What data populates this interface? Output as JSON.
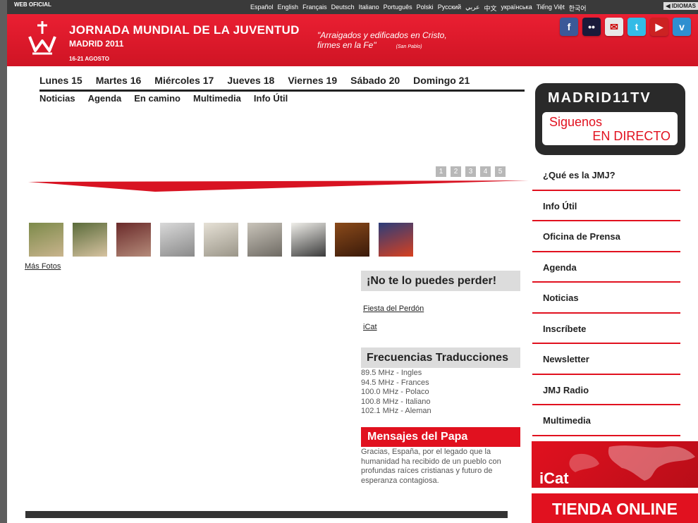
{
  "topbar": {
    "label": "WEB OFICIAL",
    "languages": [
      "Español",
      "English",
      "Français",
      "Deutsch",
      "Italiano",
      "Português",
      "Polski",
      "Русский",
      "عربي",
      "中文",
      "українська",
      "Tiếng Việt",
      "한국어"
    ],
    "idiomas": "◀ IDIOMAS"
  },
  "header": {
    "title": "JORNADA MUNDIAL DE LA JUVENTUD",
    "city": "MADRID 2011",
    "dates": "16-21 AGOSTO",
    "quote_line1": "\"Arraigados y edificados en Cristo,",
    "quote_line2": "firmes en la Fe\"",
    "quote_source": "(San Pablo)"
  },
  "social": [
    {
      "name": "facebook-icon",
      "glyph": "f",
      "color": "#3b5998"
    },
    {
      "name": "flickr-icon",
      "glyph": "••",
      "color": "#1a1a3a"
    },
    {
      "name": "tuenti-icon",
      "glyph": "✉",
      "color": "#e8e8e8"
    },
    {
      "name": "twitter-icon",
      "glyph": "t",
      "color": "#33bbe6"
    },
    {
      "name": "youtube-icon",
      "glyph": "▶",
      "color": "#cc2222"
    },
    {
      "name": "vimeo-icon",
      "glyph": "v",
      "color": "#2f8fd0"
    }
  ],
  "days": [
    "Lunes 15",
    "Martes 16",
    "Miércoles 17",
    "Jueves 18",
    "Viernes 19",
    "Sábado 20",
    "Domingo 21"
  ],
  "tabs": [
    "Noticias",
    "Agenda",
    "En camino",
    "Multimedia",
    "Info Útil"
  ],
  "pager": [
    "1",
    "2",
    "3",
    "4",
    "5"
  ],
  "thumbnails": [
    {
      "colors": [
        "#7c8a4a",
        "#c9b48d"
      ]
    },
    {
      "colors": [
        "#5a6b3a",
        "#d7c3a1"
      ]
    },
    {
      "colors": [
        "#6a2a2a",
        "#b58b7a"
      ]
    },
    {
      "colors": [
        "#d9d9d9",
        "#8a8a8a"
      ]
    },
    {
      "colors": [
        "#e6e1d6",
        "#9a9588"
      ]
    },
    {
      "colors": [
        "#c9c4ba",
        "#6e6a63"
      ]
    },
    {
      "colors": [
        "#f0efea",
        "#3a3a3a"
      ]
    },
    {
      "colors": [
        "#8a4a1a",
        "#3a1a0a"
      ]
    },
    {
      "colors": [
        "#2b3d7a",
        "#d8401f"
      ]
    }
  ],
  "mas_fotos": "Más Fotos",
  "no_te_lo_pierdas": {
    "title": "¡No te lo puedes perder!",
    "links": [
      "Fiesta del Perdón",
      "iCat"
    ]
  },
  "frecuencias": {
    "title": "Frecuencias Traducciones",
    "items": [
      "89.5 MHz - Ingles",
      "94.5 MHz - Frances",
      "100.0 MHz - Polaco",
      "100.8 MHz - Italiano",
      "102.1 MHz - Aleman"
    ]
  },
  "papa": {
    "title": "Mensajes del Papa",
    "text": "Gracias, España, por el legado que la humanidad ha recibido de un pueblo con profundas raíces cristianas y futuro de esperanza contagiosa."
  },
  "tv": {
    "title": "MADRID11TV",
    "line1": "Siguenos",
    "line2": "EN DIRECTO"
  },
  "sidebar_menu": [
    "¿Qué es la JMJ?",
    "Info Útil",
    "Oficina de Prensa",
    "Agenda",
    "Noticias",
    "Inscríbete",
    "Newsletter",
    "JMJ Radio",
    "Multimedia"
  ],
  "icat_banner": "iCat",
  "tienda": "TIENDA ONLINE",
  "colors": {
    "brand_red": "#e1111f",
    "dark": "#2a2a2a"
  }
}
